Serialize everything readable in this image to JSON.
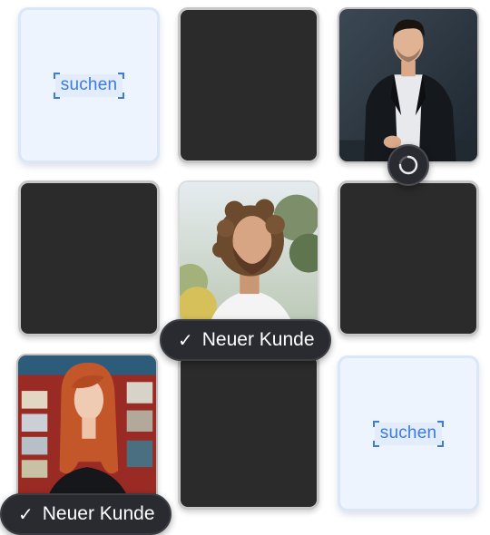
{
  "grid": {
    "tiles": [
      {
        "slot": "r1c1",
        "kind": "search",
        "label": "suchen"
      },
      {
        "slot": "r1c2",
        "kind": "empty"
      },
      {
        "slot": "r1c3",
        "kind": "photo",
        "subject": "man in dark suit"
      },
      {
        "slot": "r2c1",
        "kind": "empty"
      },
      {
        "slot": "r2c2",
        "kind": "photo",
        "subject": "bearded man with curly hair"
      },
      {
        "slot": "r2c3",
        "kind": "empty"
      },
      {
        "slot": "r3c1",
        "kind": "photo",
        "subject": "red-haired woman"
      },
      {
        "slot": "r3c2",
        "kind": "empty"
      },
      {
        "slot": "r3c3",
        "kind": "search",
        "label": "suchen"
      }
    ]
  },
  "badges": {
    "checkmark": "✓",
    "new_customer": "Neuer Kunde"
  },
  "icons": {
    "spinner": "loading-spinner-icon",
    "check": "check-icon"
  },
  "colors": {
    "tile_dark": "#2b2b2b",
    "tile_light": "#eef4fd",
    "accent_blue": "#3a7be0",
    "badge_bg": "#2a2a31"
  }
}
